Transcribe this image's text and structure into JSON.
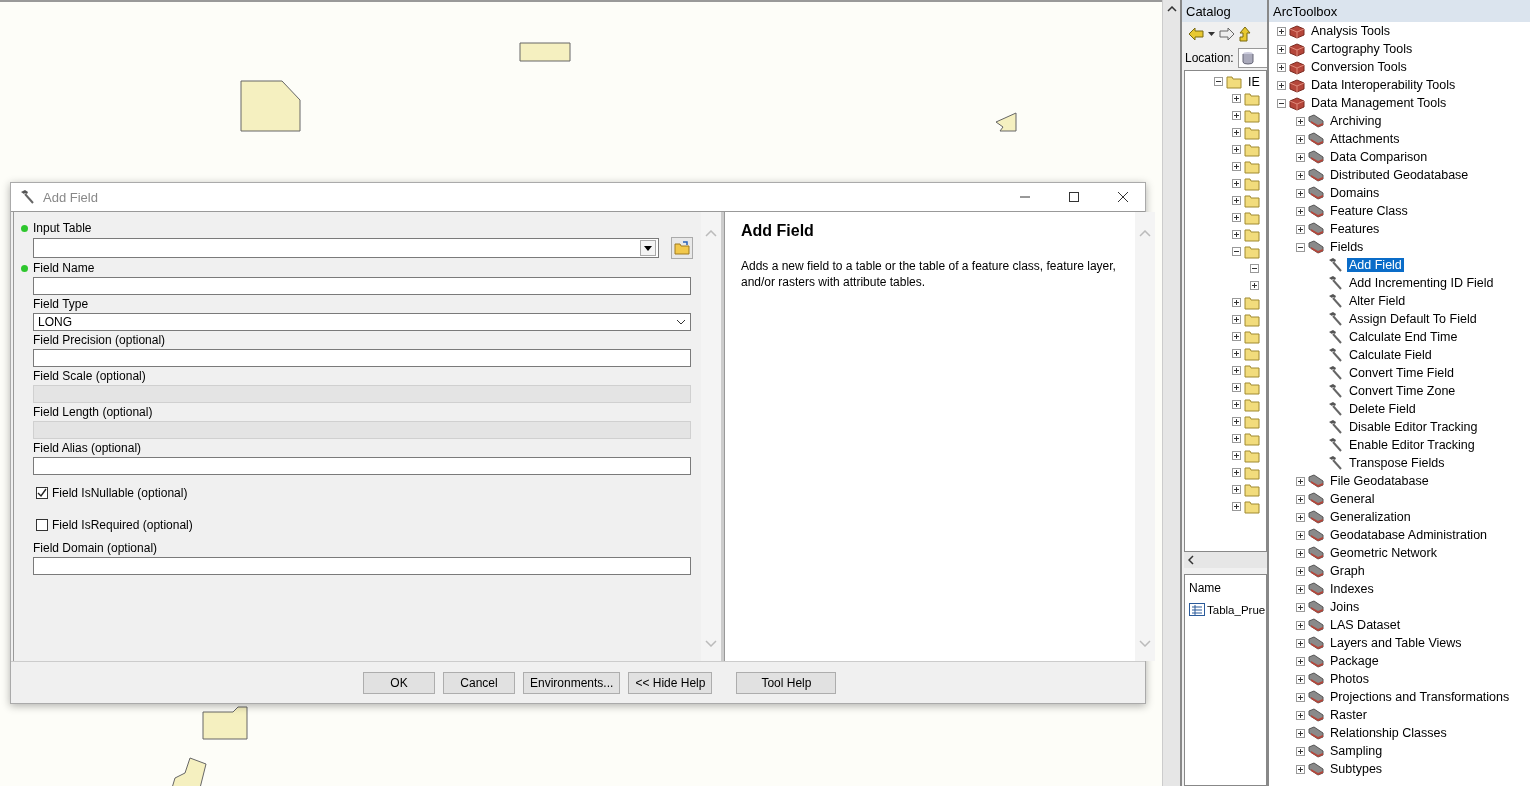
{
  "dialog": {
    "title": "Add Field",
    "parameters": [
      {
        "kind": "combo",
        "label": "Input Table",
        "required": true
      },
      {
        "kind": "text",
        "label": "Field Name",
        "required": true,
        "disabled": false
      },
      {
        "kind": "dropdown",
        "label": "Field Type",
        "required": false,
        "value": "LONG"
      },
      {
        "kind": "text",
        "label": "Field Precision (optional)",
        "required": false,
        "disabled": false
      },
      {
        "kind": "text",
        "label": "Field Scale (optional)",
        "required": false,
        "disabled": true
      },
      {
        "kind": "text",
        "label": "Field Length (optional)",
        "required": false,
        "disabled": true
      },
      {
        "kind": "text",
        "label": "Field Alias (optional)",
        "required": false,
        "disabled": false
      },
      {
        "kind": "checkbox",
        "label": "Field IsNullable (optional)",
        "checked": true
      },
      {
        "kind": "checkbox",
        "label": "Field IsRequired (optional)",
        "checked": false
      },
      {
        "kind": "text",
        "label": "Field Domain (optional)",
        "required": false,
        "disabled": false
      }
    ],
    "help": {
      "title": "Add Field",
      "text": "Adds a new field to a table or the table of a feature class, feature layer, and/or rasters with attribute tables."
    },
    "buttons": [
      "OK",
      "Cancel",
      "Environments...",
      "<< Hide Help",
      "Tool Help"
    ]
  },
  "catalog": {
    "title": "Catalog",
    "location_label": "Location:",
    "tree": {
      "label": "IE",
      "expanded": true,
      "children": [
        {
          "expanded": false
        },
        {
          "expanded": false
        },
        {
          "expanded": false
        },
        {
          "expanded": false
        },
        {
          "expanded": false
        },
        {
          "expanded": false
        },
        {
          "expanded": false
        },
        {
          "expanded": false
        },
        {
          "expanded": false
        },
        {
          "expanded": true,
          "children": [
            {
              "kind": "node",
              "expanded": true
            },
            {
              "kind": "node",
              "expanded": false
            }
          ]
        },
        {
          "expanded": false
        },
        {
          "expanded": false
        },
        {
          "expanded": false
        },
        {
          "expanded": false
        },
        {
          "expanded": false
        },
        {
          "expanded": false
        },
        {
          "expanded": false
        },
        {
          "expanded": false
        },
        {
          "expanded": false
        },
        {
          "expanded": false
        },
        {
          "expanded": false
        },
        {
          "expanded": false
        },
        {
          "expanded": false
        }
      ]
    },
    "list_header": "Name",
    "items": [
      {
        "label": "Tabla_Prue"
      }
    ]
  },
  "toolbox": {
    "title": "ArcToolbox",
    "tree": [
      {
        "kind": "toolbox",
        "label": "Analysis Tools",
        "expanded": false
      },
      {
        "kind": "toolbox",
        "label": "Cartography Tools",
        "expanded": false
      },
      {
        "kind": "toolbox",
        "label": "Conversion Tools",
        "expanded": false
      },
      {
        "kind": "toolbox",
        "label": "Data Interoperability Tools",
        "expanded": false
      },
      {
        "kind": "toolbox",
        "label": "Data Management Tools",
        "expanded": true,
        "children": [
          {
            "kind": "toolset",
            "label": "Archiving",
            "expanded": false
          },
          {
            "kind": "toolset",
            "label": "Attachments",
            "expanded": false
          },
          {
            "kind": "toolset",
            "label": "Data Comparison",
            "expanded": false
          },
          {
            "kind": "toolset",
            "label": "Distributed Geodatabase",
            "expanded": false
          },
          {
            "kind": "toolset",
            "label": "Domains",
            "expanded": false
          },
          {
            "kind": "toolset",
            "label": "Feature Class",
            "expanded": false
          },
          {
            "kind": "toolset",
            "label": "Features",
            "expanded": false
          },
          {
            "kind": "toolset",
            "label": "Fields",
            "expanded": true,
            "children": [
              {
                "kind": "tool",
                "label": "Add Field",
                "selected": true
              },
              {
                "kind": "tool",
                "label": "Add Incrementing ID Field",
                "selected": false
              },
              {
                "kind": "tool",
                "label": "Alter Field",
                "selected": false
              },
              {
                "kind": "tool",
                "label": "Assign Default To Field",
                "selected": false
              },
              {
                "kind": "tool",
                "label": "Calculate End Time",
                "selected": false
              },
              {
                "kind": "tool",
                "label": "Calculate Field",
                "selected": false
              },
              {
                "kind": "tool",
                "label": "Convert Time Field",
                "selected": false
              },
              {
                "kind": "tool",
                "label": "Convert Time Zone",
                "selected": false
              },
              {
                "kind": "tool",
                "label": "Delete Field",
                "selected": false
              },
              {
                "kind": "tool",
                "label": "Disable Editor Tracking",
                "selected": false
              },
              {
                "kind": "tool",
                "label": "Enable Editor Tracking",
                "selected": false
              },
              {
                "kind": "tool",
                "label": "Transpose Fields",
                "selected": false
              }
            ]
          },
          {
            "kind": "toolset",
            "label": "File Geodatabase",
            "expanded": false
          },
          {
            "kind": "toolset",
            "label": "General",
            "expanded": false
          },
          {
            "kind": "toolset",
            "label": "Generalization",
            "expanded": false
          },
          {
            "kind": "toolset",
            "label": "Geodatabase Administration",
            "expanded": false
          },
          {
            "kind": "toolset",
            "label": "Geometric Network",
            "expanded": false
          },
          {
            "kind": "toolset",
            "label": "Graph",
            "expanded": false
          },
          {
            "kind": "toolset",
            "label": "Indexes",
            "expanded": false
          },
          {
            "kind": "toolset",
            "label": "Joins",
            "expanded": false
          },
          {
            "kind": "toolset",
            "label": "LAS Dataset",
            "expanded": false
          },
          {
            "kind": "toolset",
            "label": "Layers and Table Views",
            "expanded": false
          },
          {
            "kind": "toolset",
            "label": "Package",
            "expanded": false
          },
          {
            "kind": "toolset",
            "label": "Photos",
            "expanded": false
          },
          {
            "kind": "toolset",
            "label": "Projections and Transformations",
            "expanded": false
          },
          {
            "kind": "toolset",
            "label": "Raster",
            "expanded": false
          },
          {
            "kind": "toolset",
            "label": "Relationship Classes",
            "expanded": false
          },
          {
            "kind": "toolset",
            "label": "Sampling",
            "expanded": false
          },
          {
            "kind": "toolset",
            "label": "Subtypes",
            "expanded": false
          }
        ]
      }
    ]
  }
}
